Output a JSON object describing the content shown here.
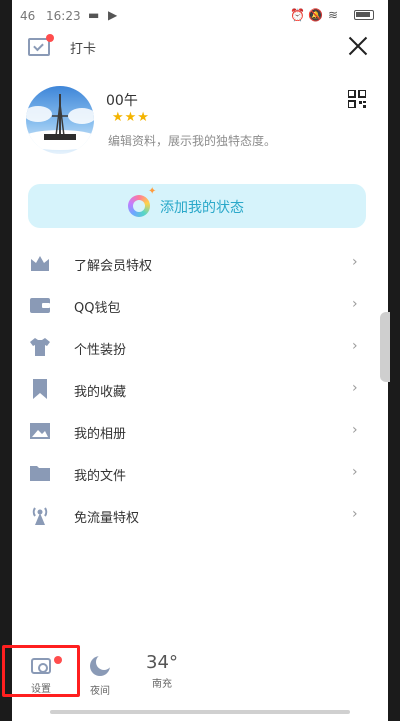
{
  "status_bar": {
    "signal": "46",
    "time": "16:23",
    "icons": [
      "video-camera-icon",
      "alarm-icon",
      "mute-icon",
      "wifi-icon",
      "battery-icon"
    ]
  },
  "header": {
    "checkin_label": "打卡",
    "close_icon": "close-icon"
  },
  "profile": {
    "nickname": "00午",
    "stars": "★★★",
    "signature": "编辑资料，展示我的独特态度。"
  },
  "add_status": {
    "label": "添加我的状态"
  },
  "menu": [
    {
      "label": "了解会员特权",
      "icon": "crown-icon"
    },
    {
      "label": "QQ钱包",
      "icon": "wallet-icon"
    },
    {
      "label": "个性装扮",
      "icon": "tshirt-icon"
    },
    {
      "label": "我的收藏",
      "icon": "bookmark-icon"
    },
    {
      "label": "我的相册",
      "icon": "photo-icon"
    },
    {
      "label": "我的文件",
      "icon": "folder-icon"
    },
    {
      "label": "免流量特权",
      "icon": "signal-tower-icon"
    }
  ],
  "bottom_bar": {
    "settings_label": "设置",
    "night_label": "夜间",
    "weather_temp": "34°",
    "weather_label": "南充"
  },
  "colors": {
    "accent_blue": "#2aa8c9",
    "icon_gray": "#8a9ab6",
    "highlight_red": "#ff1f1f"
  }
}
